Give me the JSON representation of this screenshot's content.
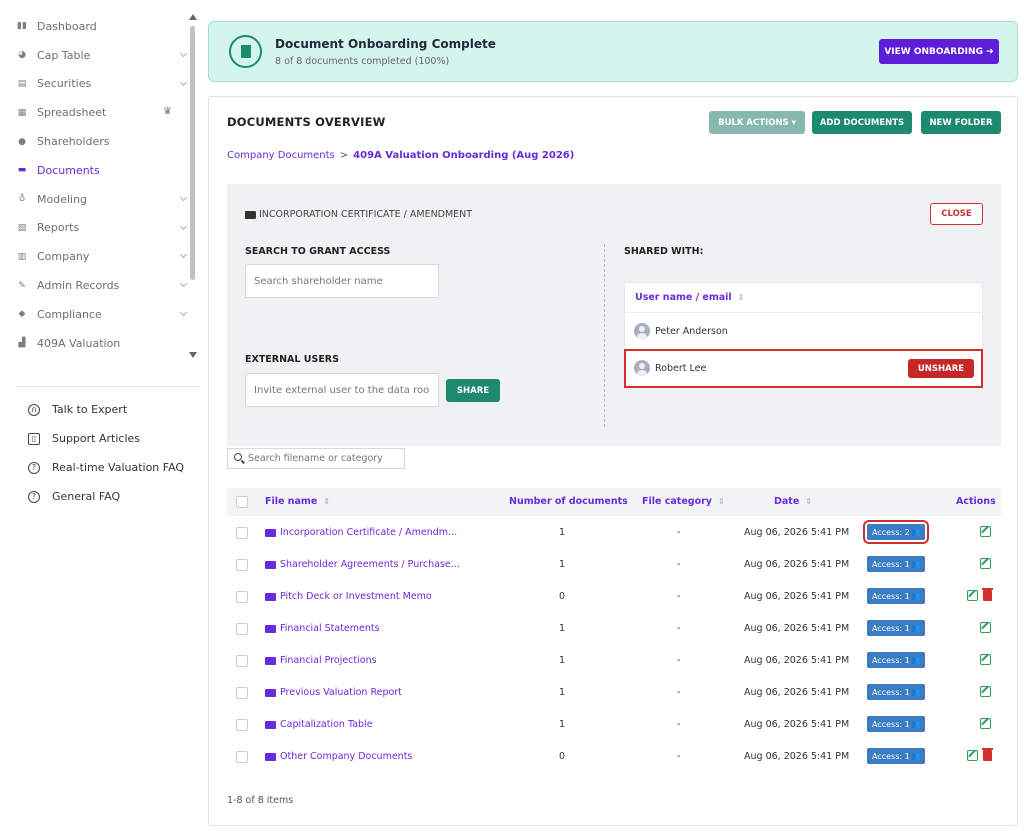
{
  "sidebar": {
    "nav": [
      {
        "label": "Dashboard",
        "icon": "dashboard-icon",
        "glyph": "▮▮",
        "chevron": false
      },
      {
        "label": "Cap Table",
        "icon": "pie-icon",
        "glyph": "◕",
        "chevron": true
      },
      {
        "label": "Securities",
        "icon": "clipboard-icon",
        "glyph": "▤",
        "chevron": true
      },
      {
        "label": "Spreadsheet",
        "icon": "spreadsheet-icon",
        "glyph": "▦",
        "chevron": false,
        "crown": true
      },
      {
        "label": "Shareholders",
        "icon": "person-icon",
        "glyph": "●",
        "chevron": false
      },
      {
        "label": "Documents",
        "icon": "folder-icon",
        "glyph": "▬",
        "chevron": false,
        "active": true
      },
      {
        "label": "Modeling",
        "icon": "bulb-icon",
        "glyph": "♁",
        "chevron": true
      },
      {
        "label": "Reports",
        "icon": "report-icon",
        "glyph": "▧",
        "chevron": true
      },
      {
        "label": "Company",
        "icon": "building-icon",
        "glyph": "▥",
        "chevron": true
      },
      {
        "label": "Admin Records",
        "icon": "records-icon",
        "glyph": "✎",
        "chevron": true
      },
      {
        "label": "Compliance",
        "icon": "shield-icon",
        "glyph": "◆",
        "chevron": true
      },
      {
        "label": "409A Valuation",
        "icon": "chart-icon",
        "glyph": "▟",
        "chevron": false
      }
    ],
    "help": [
      {
        "label": "Talk to Expert",
        "icon": "headset-icon",
        "glyph": "∩"
      },
      {
        "label": "Support Articles",
        "icon": "book-icon",
        "glyph": "▯"
      },
      {
        "label": "Real-time Valuation FAQ",
        "icon": "question-icon",
        "glyph": "?"
      },
      {
        "label": "General FAQ",
        "icon": "question-icon",
        "glyph": "?"
      }
    ]
  },
  "banner": {
    "title": "Document Onboarding Complete",
    "subtitle": "8 of 8 documents completed (100%)",
    "button": "VIEW ONBOARDING ➔"
  },
  "header": {
    "title": "DOCUMENTS OVERVIEW",
    "bulk_actions": "BULK ACTIONS ▾",
    "add_documents": "ADD DOCUMENTS",
    "new_folder": "NEW FOLDER"
  },
  "breadcrumb": {
    "root": "Company Documents",
    "separator": ">",
    "current": "409A Valuation Onboarding (Aug 2026)"
  },
  "panel": {
    "folder_title": "INCORPORATION CERTIFICATE / AMENDMENT",
    "close": "CLOSE",
    "search_label": "SEARCH TO GRANT ACCESS",
    "search_placeholder": "Search shareholder name",
    "external_label": "EXTERNAL USERS",
    "external_placeholder": "Invite external user to the data room",
    "share": "SHARE",
    "shared_with_label": "SHARED WITH:",
    "shared_column": "User name / email",
    "shared_users": [
      {
        "name": "Peter Anderson"
      },
      {
        "name": "Robert Lee",
        "unshare": "UNSHARE"
      }
    ]
  },
  "files": {
    "search_placeholder": "Search filename or category",
    "columns": {
      "name": "File name",
      "count": "Number of documents",
      "category": "File category",
      "date": "Date",
      "actions": "Actions"
    },
    "rows": [
      {
        "name": "Incorporation Certificate / Amendm...",
        "count": "1",
        "category": "-",
        "date": "Aug 06, 2026 5:41 PM",
        "access": "Access: 2",
        "delete": false
      },
      {
        "name": "Shareholder Agreements / Purchase...",
        "count": "1",
        "category": "-",
        "date": "Aug 06, 2026 5:41 PM",
        "access": "Access: 1",
        "delete": false
      },
      {
        "name": "Pitch Deck or Investment Memo",
        "count": "0",
        "category": "-",
        "date": "Aug 06, 2026 5:41 PM",
        "access": "Access: 1",
        "delete": true
      },
      {
        "name": "Financial Statements",
        "count": "1",
        "category": "-",
        "date": "Aug 06, 2026 5:41 PM",
        "access": "Access: 1",
        "delete": false
      },
      {
        "name": "Financial Projections",
        "count": "1",
        "category": "-",
        "date": "Aug 06, 2026 5:41 PM",
        "access": "Access: 1",
        "delete": false
      },
      {
        "name": "Previous Valuation Report",
        "count": "1",
        "category": "-",
        "date": "Aug 06, 2026 5:41 PM",
        "access": "Access: 1",
        "delete": false
      },
      {
        "name": "Capitalization Table",
        "count": "1",
        "category": "-",
        "date": "Aug 06, 2026 5:41 PM",
        "access": "Access: 1",
        "delete": false
      },
      {
        "name": "Other Company Documents",
        "count": "0",
        "category": "-",
        "date": "Aug 06, 2026 5:41 PM",
        "access": "Access: 1",
        "delete": true
      }
    ],
    "footer": "1-8 of 8 items"
  },
  "colors": {
    "accent": "#6a2bd9",
    "primary_green": "#1d8a70",
    "danger": "#c62828",
    "access_blue": "#3a7dc4"
  }
}
